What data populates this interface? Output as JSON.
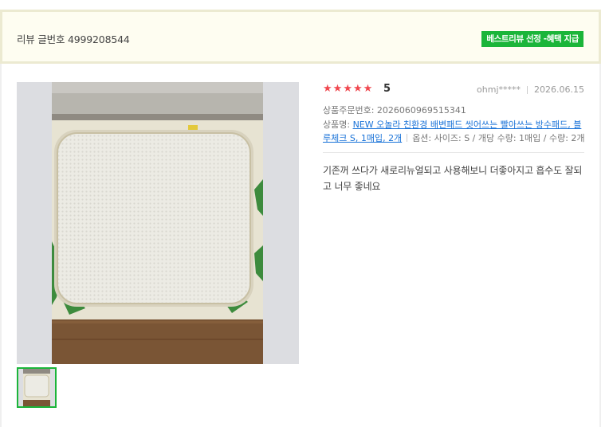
{
  "header": {
    "review_number": "리뷰 글번호 4999208544",
    "best_badge": "베스트리뷰 선정 -혜택 지급"
  },
  "review": {
    "stars": [
      "★",
      "★",
      "★",
      "★",
      "★"
    ],
    "score": "5",
    "author": "ohmj*****",
    "date": "2026.06.15",
    "order_number": "상품주문번호: 2026060969515341",
    "product_prefix": "상품명: ",
    "product_name": "NEW 오놀라 친환경 배변패드 씻어쓰는 빨아쓰는 방수패드, 블루체크 S, 1매입, 2개",
    "options": "옵션: 사이즈: S / 개당 수량: 1매입 / 수량: 2개",
    "text": "기존꺼 쓰다가 새로리뉴얼되고 사용해보니 더좋아지고 흡수도 잘되고 너무 좋네요"
  },
  "colors": {
    "badge_green": "#1bb53a",
    "star_red": "#f0474e",
    "link_blue": "#1a73d8",
    "header_bg": "#fefdf1"
  }
}
